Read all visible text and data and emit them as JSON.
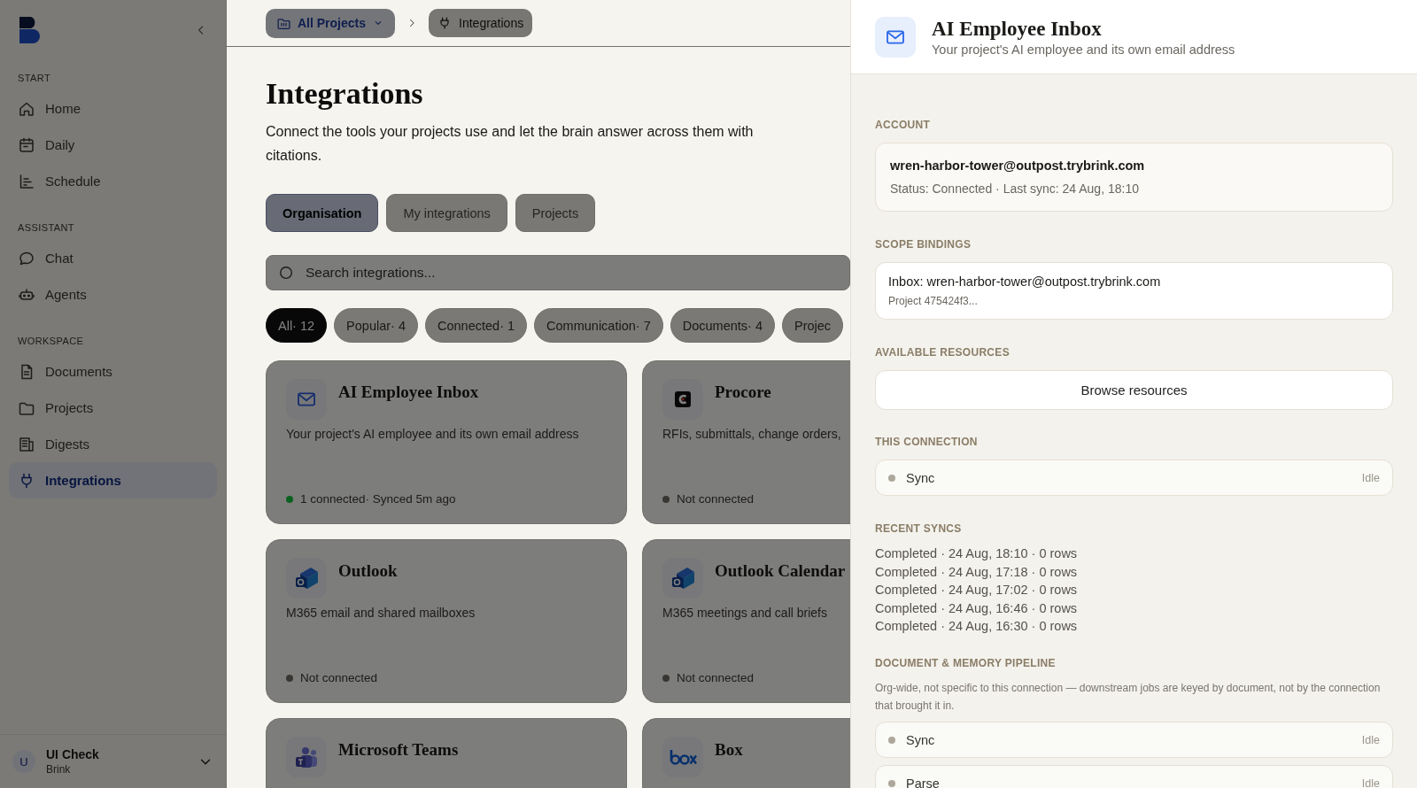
{
  "sidebar": {
    "sections": [
      {
        "label": "START",
        "items": [
          {
            "label": "Home",
            "selected": false
          },
          {
            "label": "Daily",
            "selected": false
          },
          {
            "label": "Schedule",
            "selected": false
          }
        ]
      },
      {
        "label": "ASSISTANT",
        "items": [
          {
            "label": "Chat",
            "selected": false
          },
          {
            "label": "Agents",
            "selected": false
          }
        ]
      },
      {
        "label": "WORKSPACE",
        "items": [
          {
            "label": "Documents",
            "selected": false
          },
          {
            "label": "Projects",
            "selected": false
          },
          {
            "label": "Digests",
            "selected": false
          },
          {
            "label": "Integrations",
            "selected": true
          }
        ]
      }
    ],
    "user": {
      "initial": "U",
      "name": "UI Check",
      "org": "Brink"
    }
  },
  "breadcrumb": {
    "project": "All Projects",
    "current": "Integrations"
  },
  "page": {
    "title": "Integrations",
    "description": "Connect the tools your projects use and let the brain answer across them with citations."
  },
  "tabs": [
    {
      "label": "Organisation",
      "selected": true
    },
    {
      "label": "My integrations",
      "selected": false
    },
    {
      "label": "Projects",
      "selected": false
    }
  ],
  "search": {
    "placeholder": "Search integrations..."
  },
  "filters": [
    {
      "label": "All· 12",
      "selected": true
    },
    {
      "label": "Popular· 4",
      "selected": false
    },
    {
      "label": "Connected· 1",
      "selected": false
    },
    {
      "label": "Communication· 7",
      "selected": false
    },
    {
      "label": "Documents· 4",
      "selected": false
    },
    {
      "label": "Projec",
      "selected": false
    }
  ],
  "cards": [
    {
      "title": "AI Employee Inbox",
      "description": "Your project's AI employee and its own email address",
      "status": "1 connected· Synced 5m ago",
      "connected": true
    },
    {
      "title": "Procore",
      "description": "RFIs, submittals, change orders,",
      "status": "Not connected",
      "connected": false
    },
    {
      "title": "Outlook",
      "description": "M365 email and shared mailboxes",
      "status": "Not connected",
      "connected": false
    },
    {
      "title": "Outlook Calendar",
      "description": "M365 meetings and call briefs",
      "status": "Not connected",
      "connected": false
    },
    {
      "title": "Microsoft Teams"
    },
    {
      "title": "Box"
    }
  ],
  "panel": {
    "title": "AI Employee Inbox",
    "subtitle": "Your project's AI employee and its own email address",
    "account": {
      "label": "ACCOUNT",
      "email": "wren-harbor-tower@outpost.trybrink.com",
      "status": "Status: Connected · Last sync: 24 Aug, 18:10"
    },
    "scope": {
      "label": "SCOPE BINDINGS",
      "inbox": "Inbox: wren-harbor-tower@outpost.trybrink.com",
      "project": "Project 475424f3..."
    },
    "resources": {
      "label": "AVAILABLE RESOURCES",
      "button": "Browse resources"
    },
    "connection": {
      "label": "THIS CONNECTION",
      "jobs": [
        {
          "name": "Sync",
          "status": "Idle"
        }
      ]
    },
    "recent": {
      "label": "RECENT SYNCS",
      "items": [
        "Completed · 24 Aug, 18:10 · 0 rows",
        "Completed · 24 Aug, 17:18 · 0 rows",
        "Completed · 24 Aug, 17:02 · 0 rows",
        "Completed · 24 Aug, 16:46 · 0 rows",
        "Completed · 24 Aug, 16:30 · 0 rows"
      ]
    },
    "pipeline": {
      "label": "DOCUMENT & MEMORY PIPELINE",
      "note": "Org-wide, not specific to this connection — downstream jobs are keyed by document, not by the connection that brought it in.",
      "jobs": [
        {
          "name": "Sync",
          "status": "Idle"
        },
        {
          "name": "Parse",
          "status": "Idle"
        }
      ]
    }
  }
}
